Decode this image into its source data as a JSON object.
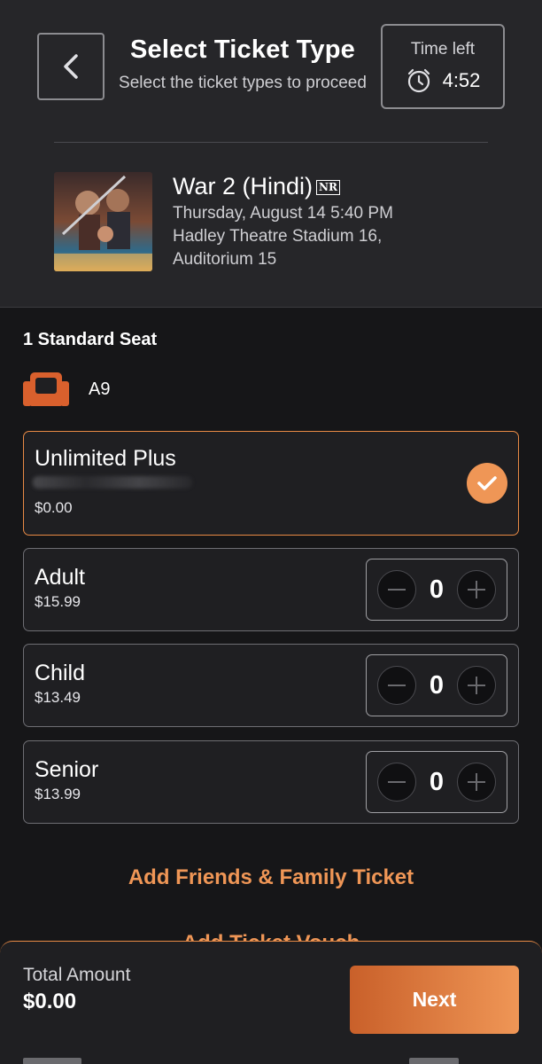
{
  "header": {
    "title": "Select Ticket Type",
    "subtitle": "Select the ticket types to proceed",
    "timer": {
      "label": "Time left",
      "value": "4:52"
    }
  },
  "movie": {
    "title": "War 2 (Hindi)",
    "rating": "NR",
    "showtime": "Thursday, August 14 5:40 PM",
    "theatre": "Hadley Theatre Stadium 16,",
    "auditorium": "Auditorium 15"
  },
  "seats": {
    "heading": "1 Standard Seat",
    "seat_id": "A9"
  },
  "tickets": [
    {
      "name": "Unlimited Plus",
      "price": "$0.00",
      "selected": true
    },
    {
      "name": "Adult",
      "price": "$15.99",
      "qty": "0"
    },
    {
      "name": "Child",
      "price": "$13.49",
      "qty": "0"
    },
    {
      "name": "Senior",
      "price": "$13.99",
      "qty": "0"
    }
  ],
  "links": {
    "friends_family": "Add Friends & Family Ticket",
    "voucher_partial": "Add Ticket Vouch"
  },
  "footer": {
    "total_label": "Total Amount",
    "total_value": "$0.00",
    "next_label": "Next"
  },
  "colors": {
    "accent": "#ef9656",
    "accent_dark": "#c9602a",
    "seat_icon": "#d9602d"
  },
  "icons": {
    "back": "chevron-left-icon",
    "timer": "alarm-clock-icon",
    "seat": "seat-icon",
    "check": "check-icon",
    "minus": "minus-icon",
    "plus": "plus-icon"
  }
}
